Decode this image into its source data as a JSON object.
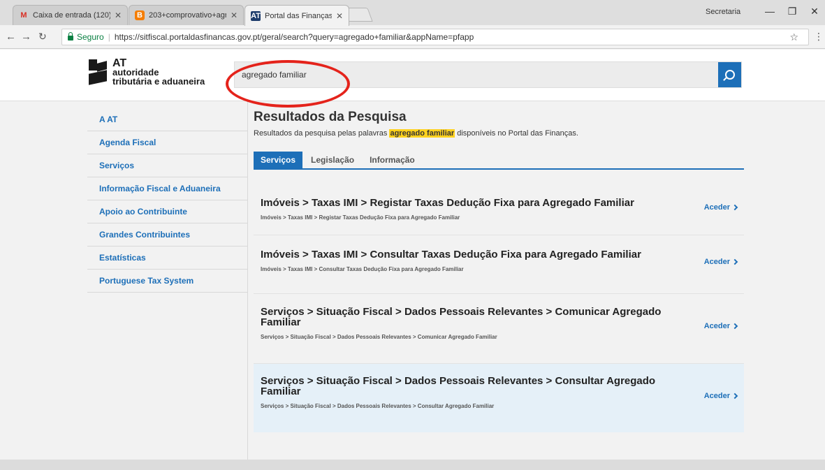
{
  "browser": {
    "tabs": [
      {
        "label": "Caixa de entrada (120) -",
        "favicon": "gmail-icon"
      },
      {
        "label": "203+comprovativo+agre",
        "favicon": "blogger-icon"
      },
      {
        "label": "Portal das Finanças",
        "favicon": "at-icon"
      }
    ],
    "profile": "Secretaria",
    "secure_label": "Seguro",
    "url": "https://sitfiscal.portaldasfinancas.gov.pt/geral/search?query=agregado+familiar&appName=pfapp"
  },
  "header": {
    "logo_line1": "AT",
    "logo_line2": "autoridade",
    "logo_line3": "tributária e aduaneira",
    "search_value": "agregado familiar"
  },
  "sidebar": {
    "items": [
      {
        "label": "A AT"
      },
      {
        "label": "Agenda Fiscal"
      },
      {
        "label": "Serviços"
      },
      {
        "label": "Informação Fiscal e Aduaneira"
      },
      {
        "label": "Apoio ao Contribuinte"
      },
      {
        "label": "Grandes Contribuintes"
      },
      {
        "label": "Estatísticas"
      },
      {
        "label": "Portuguese Tax System"
      }
    ]
  },
  "main": {
    "title": "Resultados da Pesquisa",
    "subtitle_before": "Resultados da pesquisa pelas palavras",
    "subtitle_highlight": "agregado familiar",
    "subtitle_after": "disponíveis no Portal das Finanças.",
    "tabs": [
      {
        "label": "Serviços"
      },
      {
        "label": "Legislação"
      },
      {
        "label": "Informação"
      }
    ],
    "results": [
      {
        "title": "Imóveis > Taxas IMI > Registar Taxas Dedução Fixa para Agregado Familiar",
        "path": "Imóveis > Taxas IMI > Registar Taxas Dedução Fixa para Agregado Familiar",
        "action": "Aceder"
      },
      {
        "title": "Imóveis > Taxas IMI > Consultar Taxas Dedução Fixa para Agregado Familiar",
        "path": "Imóveis > Taxas IMI > Consultar Taxas Dedução Fixa para Agregado Familiar",
        "action": "Aceder"
      },
      {
        "title": "Serviços > Situação Fiscal > Dados Pessoais Relevantes > Comunicar Agregado Familiar",
        "path": "Serviços > Situação Fiscal > Dados Pessoais Relevantes > Comunicar Agregado Familiar",
        "action": "Aceder"
      },
      {
        "title": "Serviços > Situação Fiscal > Dados Pessoais Relevantes > Consultar Agregado Familiar",
        "path": "Serviços > Situação Fiscal > Dados Pessoais Relevantes > Consultar Agregado Familiar",
        "action": "Aceder"
      }
    ]
  },
  "colors": {
    "accent": "#1d6fb8",
    "highlight": "#ffd21f",
    "annotation": "#e4231b"
  }
}
